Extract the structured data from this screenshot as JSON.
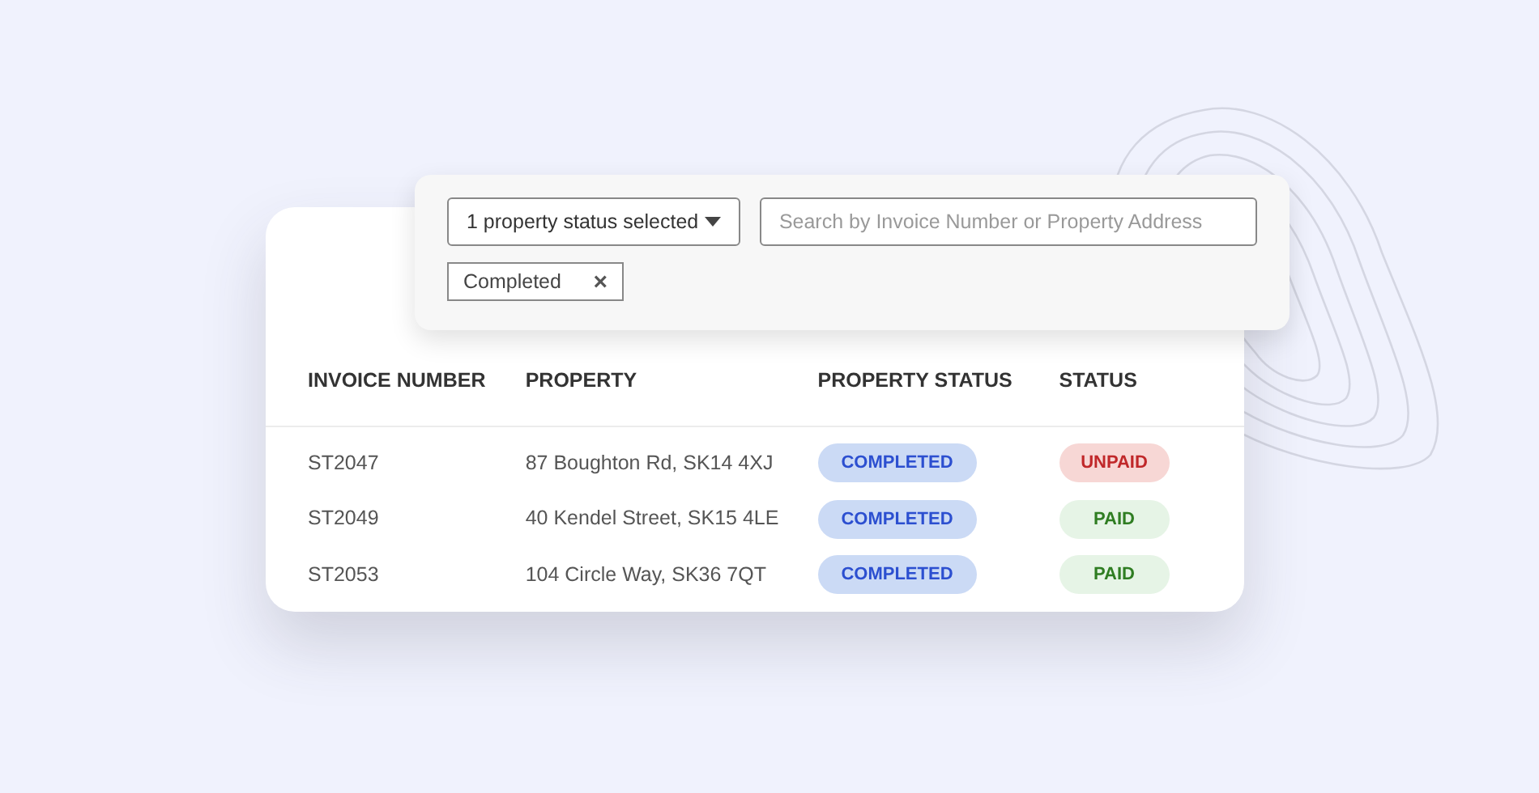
{
  "filters": {
    "dropdown": {
      "label": "1 property status selected"
    },
    "search": {
      "placeholder": "Search by Invoice Number or Property Address"
    },
    "chips": [
      {
        "label": "Completed",
        "remove": "×"
      }
    ]
  },
  "table": {
    "columns": [
      "INVOICE NUMBER",
      "PROPERTY",
      "PROPERTY STATUS",
      "STATUS"
    ],
    "rows": [
      {
        "invoice": "ST2047",
        "property": "87 Boughton Rd, SK14 4XJ",
        "property_status": {
          "label": "COMPLETED",
          "kind": "completed"
        },
        "status": {
          "label": "UNPAID",
          "kind": "unpaid"
        }
      },
      {
        "invoice": "ST2049",
        "property": "40 Kendel Street, SK15 4LE",
        "property_status": {
          "label": "COMPLETED",
          "kind": "completed"
        },
        "status": {
          "label": "PAID",
          "kind": "paid"
        }
      },
      {
        "invoice": "ST2053",
        "property": "104 Circle Way, SK36 7QT",
        "property_status": {
          "label": "COMPLETED",
          "kind": "completed"
        },
        "status": {
          "label": "PAID",
          "kind": "paid"
        }
      }
    ]
  }
}
